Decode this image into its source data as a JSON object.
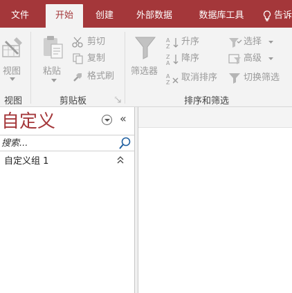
{
  "tabs": [
    {
      "label": "文件",
      "active": false
    },
    {
      "label": "开始",
      "active": true
    },
    {
      "label": "创建",
      "active": false
    },
    {
      "label": "外部数据",
      "active": false
    },
    {
      "label": "数据库工具",
      "active": false
    }
  ],
  "tell_me": {
    "label": "告诉"
  },
  "ribbon": {
    "view_group": {
      "button_label": "视图",
      "group_label": "视图"
    },
    "clipboard_group": {
      "paste_label": "粘贴",
      "cut_label": "剪切",
      "copy_label": "复制",
      "format_painter_label": "格式刷",
      "group_label": "剪贴板"
    },
    "sort_filter_group": {
      "filter_label": "筛选器",
      "ascending_label": "升序",
      "descending_label": "降序",
      "remove_sort_label": "取消排序",
      "selection_label": "选择",
      "advanced_label": "高级",
      "toggle_filter_label": "切换筛选",
      "group_label": "排序和筛选"
    }
  },
  "nav_pane": {
    "title": "自定义",
    "collapse_glyph": "«",
    "search_placeholder": "搜索...",
    "groups": [
      {
        "label": "自定义组 1",
        "toggle_glyph": "⌃"
      }
    ]
  },
  "colors": {
    "accent": "#a4373a",
    "ribbon_bg": "#f3f3f3",
    "disabled_text": "#9a9a9a"
  }
}
